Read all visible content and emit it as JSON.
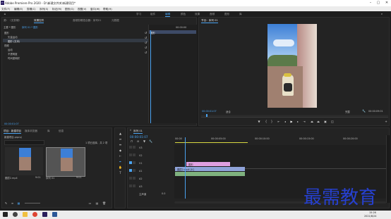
{
  "title": "Adobe Premiere Pro 2020 - D:\\新建文件夹\\新建项目*",
  "menu": [
    "文件(F)",
    "编辑(E)",
    "剪辑(C)",
    "序列(S)",
    "标记(M)",
    "图形(G)",
    "视图(V)",
    "窗口(W)",
    "帮助(H)"
  ],
  "workspaces": [
    "学习",
    "组件",
    "编辑",
    "颜色",
    "效果",
    "音频",
    "图形",
    "库"
  ],
  "effect_controls": {
    "tabs": [
      "源：（无剪辑）",
      "效果控件",
      "音频剪辑混合器：序列01",
      "元数据"
    ],
    "source_label": "主要 * 图形",
    "seq_label": "序列 01 * 图形",
    "timecode_ruler": "00:00:00",
    "graphic_clip": "图形",
    "rows": [
      {
        "label": "图形",
        "indent": 0
      },
      {
        "label": "矢量运动",
        "indent": 1
      },
      {
        "label": "图形 (文本)",
        "indent": 1
      },
      {
        "label": "视频",
        "indent": 0
      },
      {
        "label": "运动",
        "indent": 1
      },
      {
        "label": "不透明度",
        "indent": 1
      },
      {
        "label": "时间重映射",
        "indent": 1
      }
    ],
    "bottom_time": "00:00:01:07"
  },
  "program": {
    "tab": "节目：序列 01",
    "timecode_left": "00:00:01:07",
    "fit": "适合",
    "quality": "完整",
    "timecode_right": "00:00:09:01"
  },
  "project": {
    "tabs": [
      "项目：新建项目",
      "媒体浏览器",
      "库",
      "信息"
    ],
    "name": "新建项目.prproj",
    "count": "1 项已选择，共 2 项",
    "items": [
      {
        "name": "图层2.mp4",
        "duration": "9:01"
      },
      {
        "name": "序列 01",
        "duration": "9:01"
      }
    ]
  },
  "timeline": {
    "tab": "序列 01",
    "timecode": "00:00:01:07",
    "ruler": [
      "00:00",
      "00:00:05:00",
      "00:00:10:00",
      "00:00:15:00",
      "00:00:20:00"
    ],
    "tracks": [
      "V3",
      "V2",
      "V1",
      "A1",
      "A2",
      "A3",
      "主声道"
    ],
    "master_level": "0.0",
    "graphic_clip": "图形",
    "video_clip": "图层2.mp4 [V]",
    "audio_clip": ""
  },
  "watermark": "最需教育",
  "taskbar": {
    "time": "15:26",
    "date": "2021/8/24"
  },
  "colors": {
    "accent": "#4aa3f0",
    "graphic_clip": "#e0a0e0",
    "video_clip": "#8fa3d9",
    "audio_clip": "#7fb27f"
  }
}
